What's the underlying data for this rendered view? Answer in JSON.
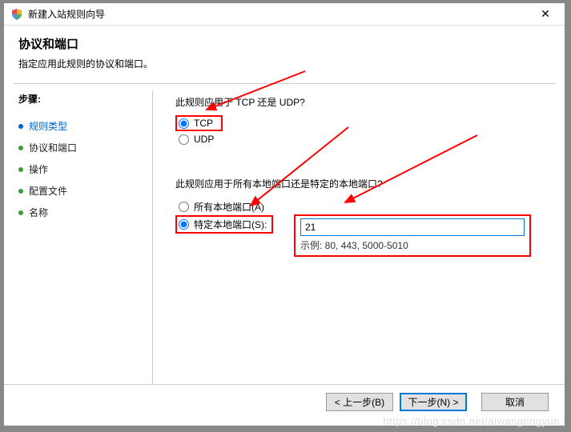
{
  "title": "新建入站规则向导",
  "header": {
    "title": "协议和端口",
    "subtitle": "指定应用此规则的协议和端口。"
  },
  "sidebar": {
    "heading": "步骤:",
    "items": [
      {
        "label": "规则类型"
      },
      {
        "label": "协议和端口"
      },
      {
        "label": "操作"
      },
      {
        "label": "配置文件"
      },
      {
        "label": "名称"
      }
    ]
  },
  "content": {
    "q1": "此规则应用于 TCP 还是 UDP?",
    "tcp_label": "TCP",
    "udp_label": "UDP",
    "q2": "此规则应用于所有本地端口还是特定的本地端口?",
    "all_ports_label": "所有本地端口(A)",
    "specific_ports_label": "特定本地端口(S):",
    "port_value": "21",
    "port_example": "示例: 80, 443, 5000-5010"
  },
  "buttons": {
    "back": "< 上一步(B)",
    "next": "下一步(N) >",
    "cancel": "取消"
  },
  "watermark": "https://blog.csdn.net/aiwangtingyun"
}
